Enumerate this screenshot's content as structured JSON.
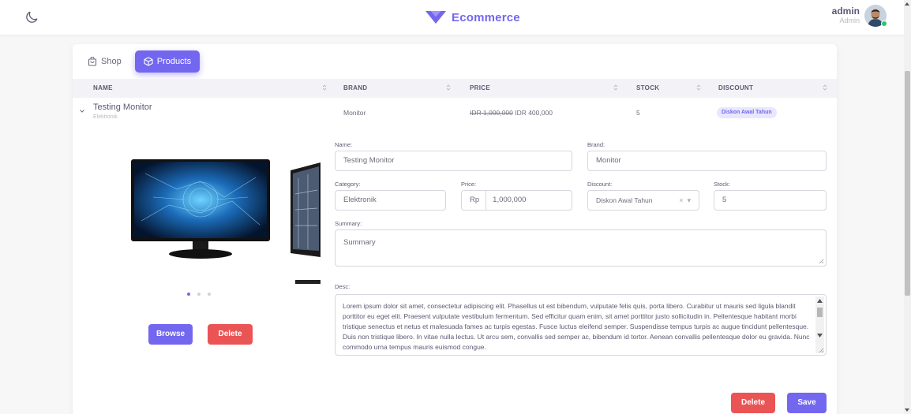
{
  "header": {
    "brand": "Ecommerce",
    "user_name": "admin",
    "user_role": "Admin",
    "accent": "#7367f0"
  },
  "tabs": [
    {
      "label": "Shop",
      "icon": "shopping-bag-icon",
      "active": false
    },
    {
      "label": "Products",
      "icon": "box-icon",
      "active": true
    }
  ],
  "table": {
    "columns": [
      "NAME",
      "BRAND",
      "PRICE",
      "STOCK",
      "DISCOUNT"
    ],
    "rows": [
      {
        "name": "Testing Monitor",
        "category": "Elektronik",
        "brand": "Monitor",
        "price_old": "IDR 1,000,000",
        "price_new": "IDR 400,000",
        "stock": "5",
        "discount": "Diskon Awal Tahun"
      }
    ]
  },
  "carousel": {
    "slides": 3,
    "active_index": 0,
    "browse_label": "Browse",
    "delete_label": "Delete"
  },
  "form": {
    "name_label": "Name:",
    "name_value": "Testing Monitor",
    "brand_label": "Brand:",
    "brand_value": "Monitor",
    "category_label": "Category:",
    "category_value": "Elektronik",
    "price_label": "Price:",
    "price_prefix": "Rp",
    "price_value": "1,000,000",
    "discount_label": "Discount:",
    "discount_value": "Diskon Awal Tahun",
    "stock_label": "Stock:",
    "stock_value": "5",
    "summary_label": "Summary:",
    "summary_placeholder": "Summary",
    "desc_label": "Desc:",
    "desc_value": "Lorem ipsum dolor sit amet, consectetur adipiscing elit. Phasellus ut est bibendum, vulputate felis quis, porta libero. Curabitur ut mauris sed ligula blandit porttitor eu eget elit. Praesent vulputate vestibulum fermentum. Sed efficitur quam enim, sit amet porttitor justo sollicitudin in. Pellentesque habitant morbi tristique senectus et netus et malesuada fames ac turpis egestas. Fusce luctus eleifend semper. Suspendisse tempus turpis ac augue tincidunt pellentesque. Duis non tristique libero. In vitae nulla lectus. Ut arcu sem, convallis sed semper ac, bibendum id tortor. Aenean convallis pellentesque dolor eu gravida. Nunc commodo urna tempus mauris euismod congue.",
    "delete_label": "Delete",
    "save_label": "Save"
  }
}
